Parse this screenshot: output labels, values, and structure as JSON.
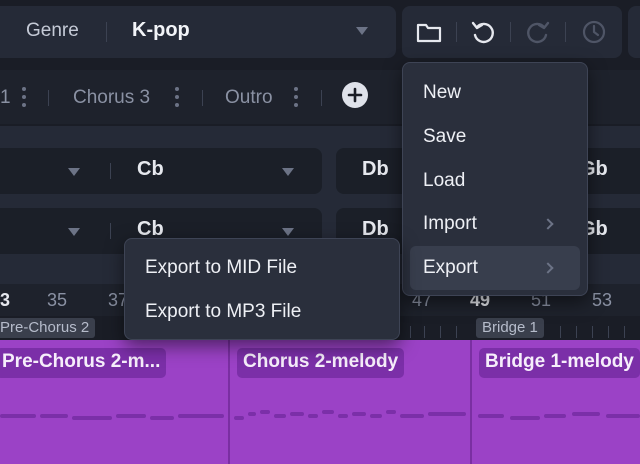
{
  "header": {
    "genre_label": "Genre",
    "genre_value": "K-pop",
    "icons": [
      "folder-icon",
      "undo-icon",
      "redo-icon",
      "history-icon"
    ]
  },
  "sections": [
    {
      "label": "1"
    },
    {
      "label": "Chorus 3"
    },
    {
      "label": "Outro"
    }
  ],
  "chords": {
    "row1": {
      "a": "Cb",
      "b": "Db",
      "c": "Gb"
    },
    "row2": {
      "a": "Cb",
      "b": "Db",
      "c": "Gb"
    }
  },
  "ruler": [
    "3",
    "35",
    "37",
    "47",
    "49",
    "51",
    "53"
  ],
  "markers": {
    "pre_chorus": "Pre-Chorus 2",
    "bridge": "Bridge 1"
  },
  "clips": [
    {
      "label": "Pre-Chorus 2-m..."
    },
    {
      "label": "Chorus 2-melody"
    },
    {
      "label": "Bridge 1-melody"
    }
  ],
  "menu": {
    "items": [
      "New",
      "Save",
      "Load",
      "Import",
      "Export"
    ],
    "highlighted": "Export"
  },
  "submenu": {
    "items": [
      "Export to MID File",
      "Export to MP3 File"
    ]
  },
  "colors": {
    "track": "#9b42c6",
    "clip_label": "#7b2fa8",
    "background": "#1a1d26",
    "panel": "#252a37"
  }
}
